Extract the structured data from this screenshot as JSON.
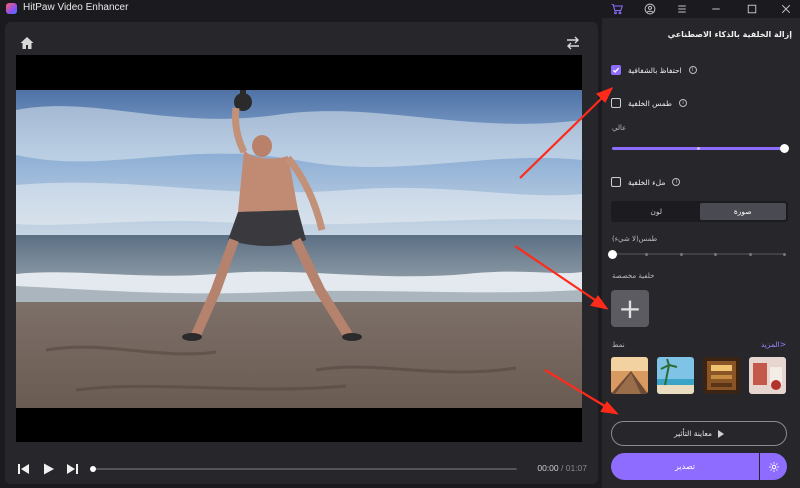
{
  "app": {
    "title": "HitPaw Video Enhancer"
  },
  "player": {
    "current_time": "00:00",
    "separator": " / ",
    "total_time": "01:07",
    "progress": 0
  },
  "panel": {
    "title": "إزالة الخلفية بالذكاء الاصطناعي",
    "keep_transparent": {
      "label": "احتفاظ بالشفافية",
      "checked": true
    },
    "blur_background": {
      "label": "طمس الخلفية",
      "checked": false
    },
    "blur_level_label": "عالي",
    "blur_level": 1.0,
    "fill_background": {
      "label": "ملء الخلفية",
      "checked": false
    },
    "tabs": [
      {
        "label": "لون",
        "active": false
      },
      {
        "label": "صورة",
        "active": true
      }
    ],
    "blur_none_label": "طمس(لا شيء)",
    "blur_none_level": 0,
    "custom_bg_label": "خلفية مخصصة",
    "add_icon": "plus-icon",
    "style_label": "نمط",
    "more_label": "المزيد>",
    "thumbnails": [
      "train-platform",
      "beach-palms",
      "library-interior",
      "festive-room"
    ],
    "preview_label": "معاينة التأثير",
    "export_label": "تصدير"
  },
  "colors": {
    "accent": "#8d6cff",
    "panel_bg": "#26262b",
    "app_bg": "#1b1b1f",
    "annotation_arrow": "#ff2a1a"
  }
}
